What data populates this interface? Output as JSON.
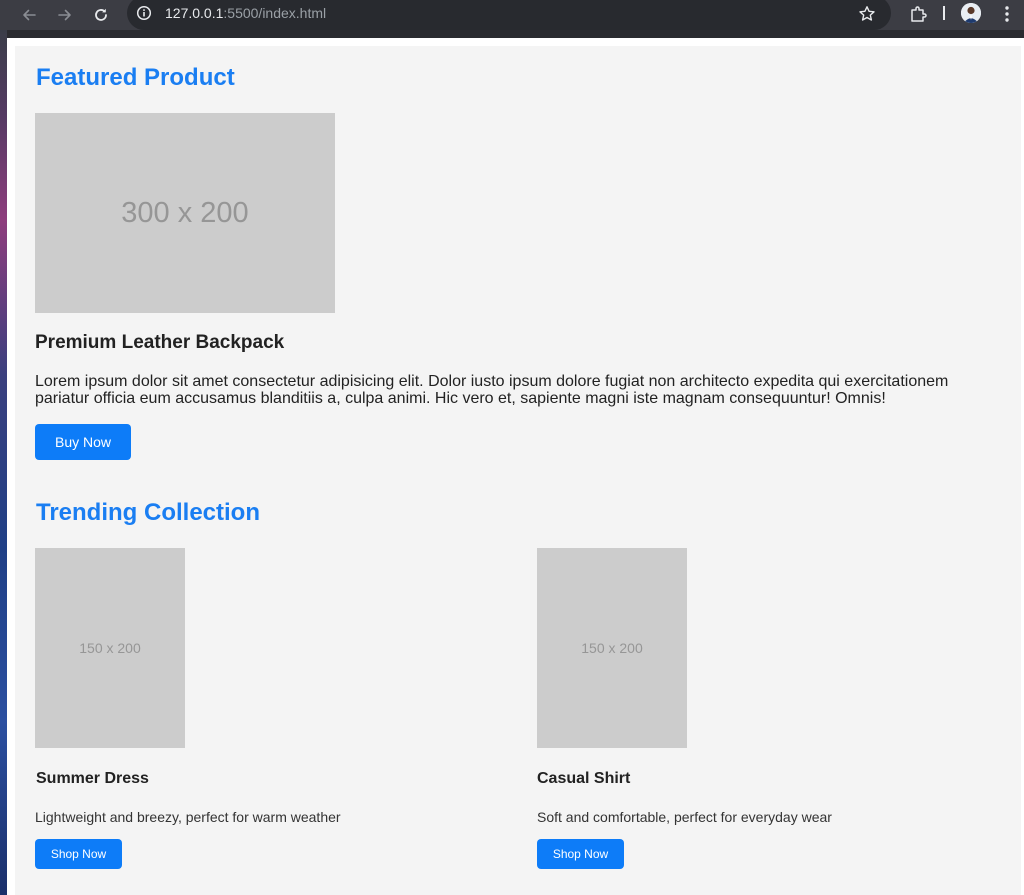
{
  "browser": {
    "url_host": "127.0.0.1",
    "url_path": ":5500/index.html"
  },
  "featured": {
    "section_title": "Featured Product",
    "image_placeholder": "300 x 200",
    "name": "Premium Leather Backpack",
    "description": "Lorem ipsum dolor sit amet consectetur adipisicing elit. Dolor iusto ipsum dolore fugiat non architecto expedita qui exercitationem pariatur officia eum accusamus blanditiis a, culpa animi. Hic vero et, sapiente magni iste magnam consequuntur! Omnis!",
    "button_label": "Buy Now"
  },
  "trending": {
    "section_title": "Trending Collection",
    "products": [
      {
        "image_placeholder": "150 x 200",
        "name": "Summer Dress",
        "description": "Lightweight and breezy, perfect for warm weather",
        "button_label": "Shop Now"
      },
      {
        "image_placeholder": "150 x 200",
        "name": "Casual Shirt",
        "description": "Soft and comfortable, perfect for everyday wear",
        "button_label": "Shop Now"
      }
    ]
  },
  "colors": {
    "accent": "#1a7ef2",
    "button": "#0d7cf8",
    "placeholder": "#cccccc",
    "page_background": "#f4f4f4"
  },
  "icons": {
    "back": "arrow-left-icon",
    "forward": "arrow-right-icon",
    "reload": "reload-icon",
    "site_info": "info-icon",
    "bookmark": "star-icon",
    "extensions": "puzzle-icon",
    "menu": "kebab-menu-icon"
  }
}
